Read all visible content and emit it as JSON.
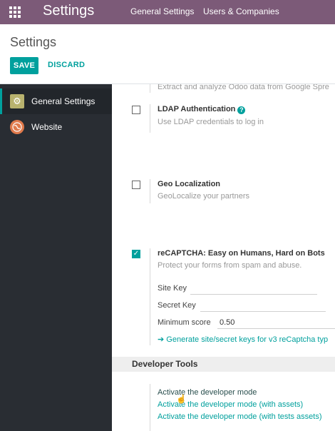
{
  "navbar": {
    "brand": "Settings",
    "menu": [
      "General Settings",
      "Users & Companies"
    ],
    "apps_icon": "apps-grid-icon",
    "color": "#7c5a78"
  },
  "control_panel": {
    "title": "Settings",
    "save_label": "SAVE",
    "discard_label": "DISCARD",
    "accent": "#00a09d"
  },
  "sidebar": {
    "items": [
      {
        "label": "General Settings",
        "icon": "gear-icon",
        "active": true
      },
      {
        "label": "Website",
        "icon": "globe-icon",
        "active": false
      }
    ]
  },
  "settings": {
    "partial_top_desc": "Extract and analyze Odoo data from Google Spre",
    "ldap": {
      "title": "LDAP Authentication",
      "desc": "Use LDAP credentials to log in",
      "checked": false
    },
    "geo": {
      "title": "Geo Localization",
      "desc": "GeoLocalize your partners",
      "checked": false
    },
    "recaptcha": {
      "title": "reCAPTCHA: Easy on Humans, Hard on Bots",
      "desc": "Protect your forms from spam and abuse.",
      "checked": true,
      "site_key_label": "Site Key",
      "secret_key_label": "Secret Key",
      "min_score_label": "Minimum score",
      "min_score_value": "0.50",
      "generate_link": "Generate site/secret keys for v3 reCaptcha typ"
    }
  },
  "developer_tools": {
    "title": "Developer Tools",
    "links": [
      "Activate the developer mode",
      "Activate the developer mode (with assets)",
      "Activate the developer mode (with tests assets)"
    ]
  }
}
